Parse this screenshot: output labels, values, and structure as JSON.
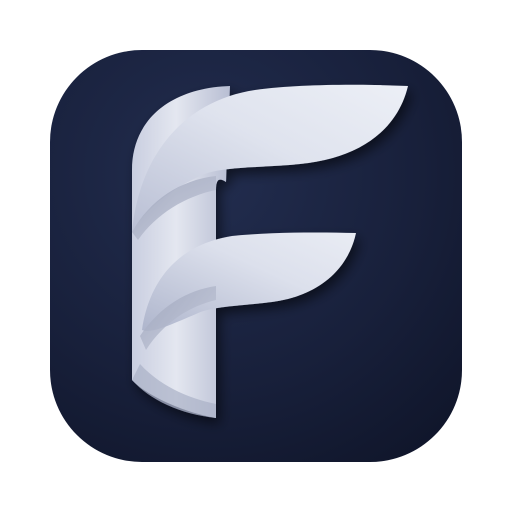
{
  "icon": {
    "kind": "app-icon",
    "glyph": "F",
    "shape": "rounded-square",
    "colors": {
      "page_background": "#ffffff",
      "tile_dark": "#141b32",
      "tile_mid": "#1f2a4a",
      "letter_light": "#e8ebf3",
      "letter_mid": "#c4c9d9",
      "letter_shadow": "#8f96ad"
    }
  }
}
